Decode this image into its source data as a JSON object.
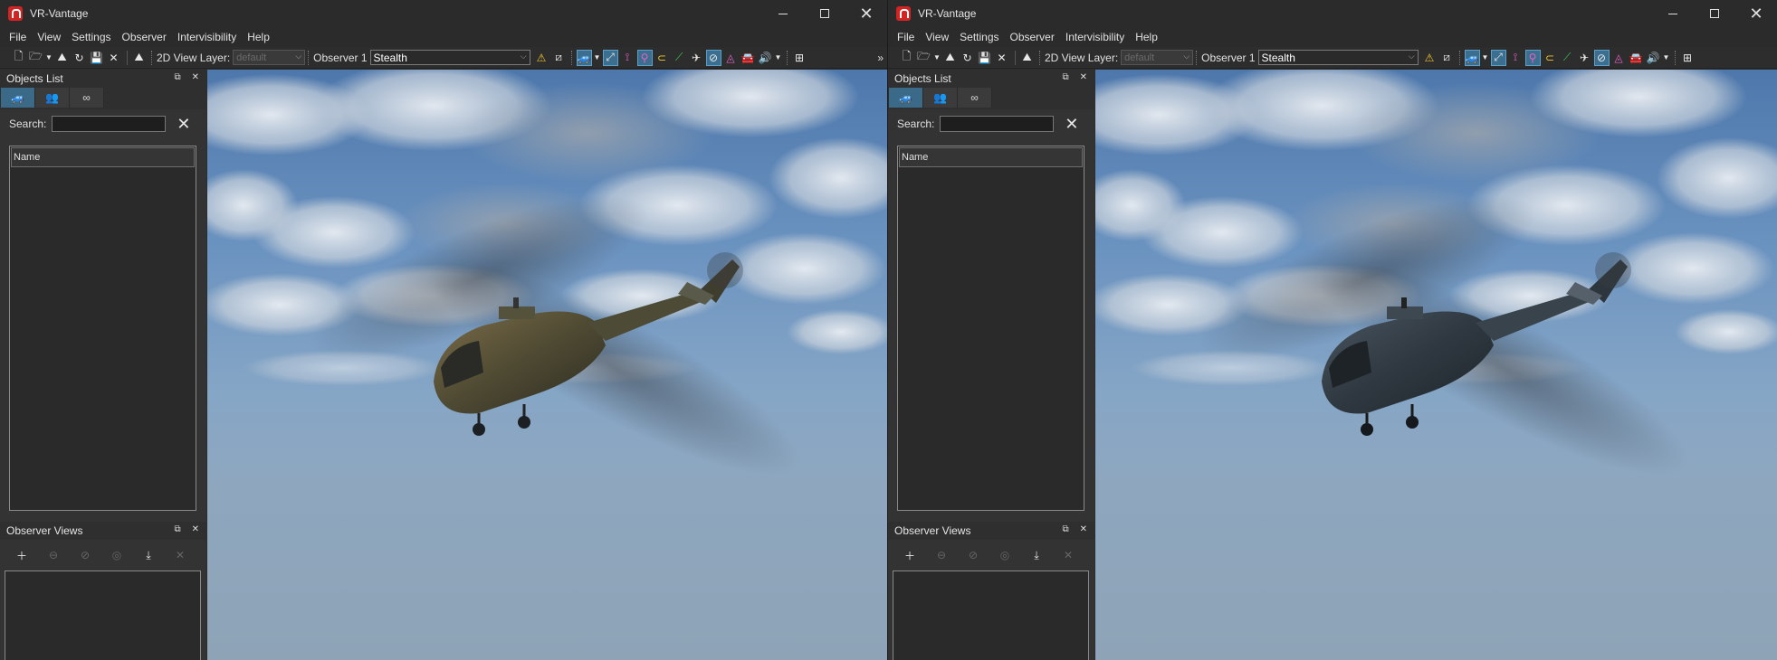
{
  "windows": [
    {
      "id": "left",
      "title": "VR-Vantage",
      "menu": [
        "File",
        "View",
        "Settings",
        "Observer",
        "Intervisibility",
        "Help"
      ],
      "toolbar": {
        "view_layer_label": "2D View Layer:",
        "view_layer_value": "default",
        "observer_label": "Observer 1",
        "observer_value": "Stealth"
      },
      "objects_list": {
        "title": "Objects List",
        "search_label": "Search:",
        "search_value": "",
        "column_name": "Name"
      },
      "observer_views": {
        "title": "Observer Views"
      },
      "helicopter_camo": "tan"
    },
    {
      "id": "right",
      "title": "VR-Vantage",
      "menu": [
        "File",
        "View",
        "Settings",
        "Observer",
        "Intervisibility",
        "Help"
      ],
      "toolbar": {
        "view_layer_label": "2D View Layer:",
        "view_layer_value": "default",
        "observer_label": "Observer 1",
        "observer_value": "Stealth"
      },
      "objects_list": {
        "title": "Objects List",
        "search_label": "Search:",
        "search_value": "",
        "column_name": "Name"
      },
      "observer_views": {
        "title": "Observer Views"
      },
      "helicopter_camo": "dark"
    }
  ],
  "colors": {
    "accent_selected": "#3b6a88",
    "app_icon_red": "#d32424",
    "panel_bg": "#333333"
  }
}
